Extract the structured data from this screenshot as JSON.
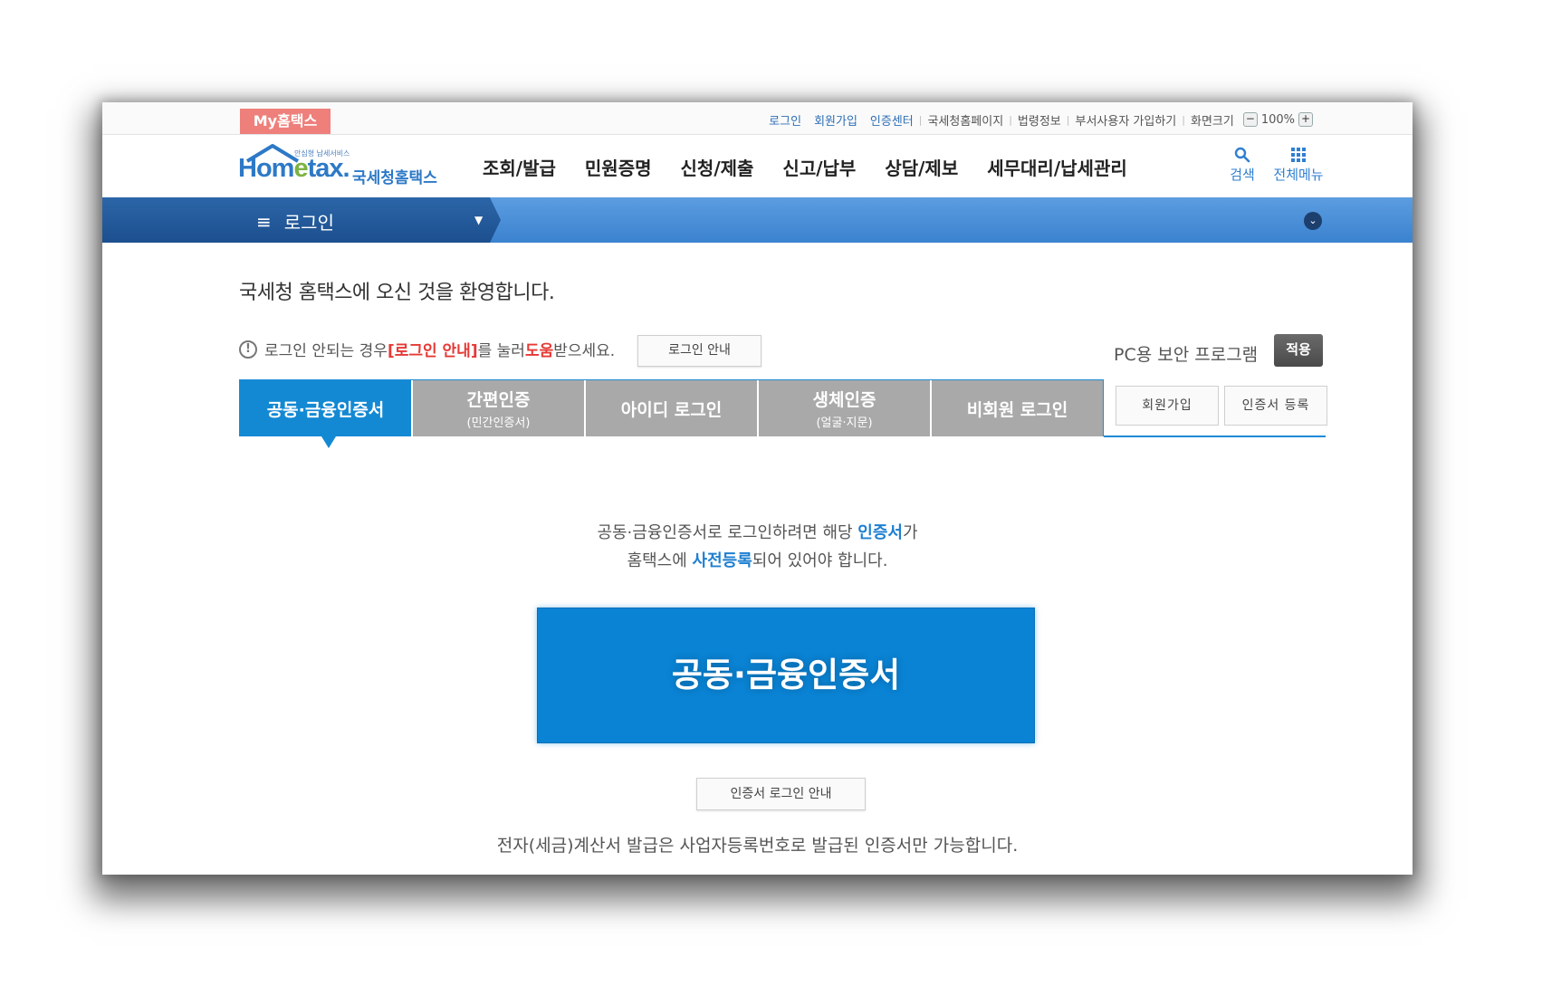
{
  "topbar": {
    "my_hometax": "My홈택스",
    "links": [
      "로그인",
      "회원가입",
      "인증센터"
    ],
    "links_plain": [
      "국세청홈페이지",
      "법령정보",
      "부서사용자 가입하기",
      "화면크기"
    ],
    "zoom_minus": "−",
    "zoom_value": "100%",
    "zoom_plus": "+"
  },
  "logo": {
    "tagline": "안심형 납세서비스",
    "home_a": "Hom",
    "home_e": "e",
    "home_b": "tax.",
    "korean": "국세청홈택스"
  },
  "nav": {
    "items": [
      "조회/발급",
      "민원증명",
      "신청/제출",
      "신고/납부",
      "상담/제보",
      "세무대리/납세관리"
    ],
    "search_label": "검색",
    "all_menu_label": "전체메뉴"
  },
  "location": {
    "menu_icon": "≡",
    "title": "로그인",
    "caret": "▼",
    "expand": "⌄"
  },
  "content": {
    "welcome": "국세청 홈택스에 오신 것을 환영합니다.",
    "notice_prefix": "로그인 안되는 경우 ",
    "notice_link": "[로그인 안내]",
    "notice_mid": "를 눌러 ",
    "notice_help": "도움",
    "notice_suffix": "받으세요.",
    "guide_button": "로그인 안내",
    "pc_security": "PC용 보안 프로그램",
    "apply_button": "적용"
  },
  "tabs": [
    {
      "label": "공동·금융인증서",
      "sub": ""
    },
    {
      "label": "간편인증",
      "sub": "(민간인증서)"
    },
    {
      "label": "아이디 로그인",
      "sub": ""
    },
    {
      "label": "생체인증",
      "sub": "(얼굴·지문)"
    },
    {
      "label": "비회원 로그인",
      "sub": ""
    }
  ],
  "side_buttons": {
    "signup": "회원가입",
    "cert_register": "인증서 등록"
  },
  "main": {
    "line1_a": "공동·금융인증서로 로그인하려면 해당 ",
    "line1_b": "인증서",
    "line1_c": "가",
    "line2_a": "홈택스에 ",
    "line2_b": "사전등록",
    "line2_c": "되어 있어야 합니다.",
    "big_button": "공동·금융인증서",
    "cert_guide_button": "인증서 로그인 안내",
    "footnote": "전자(세금)계산서 발급은 사업자등록번호로 발급된 인증서만 가능합니다."
  },
  "colors": {
    "primary_blue": "#1389d3",
    "nav_dark_blue": "#1c4f8e",
    "tag_red": "#ee7f7b",
    "alert_red": "#e53935",
    "tab_gray": "#a9a9a9"
  }
}
